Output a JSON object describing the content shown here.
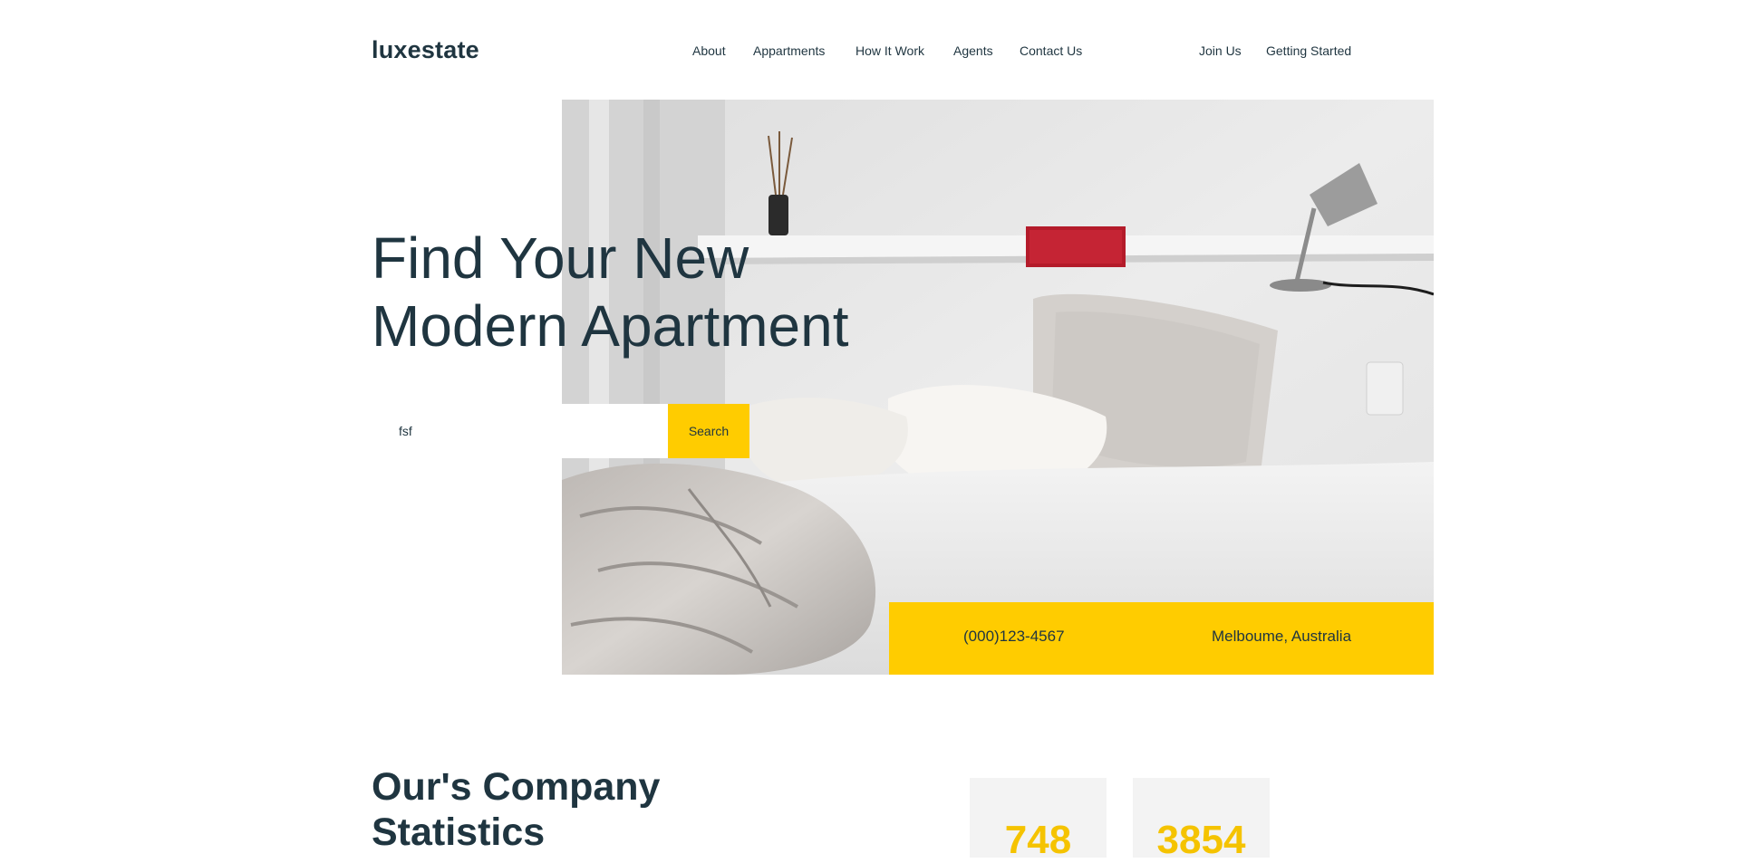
{
  "header": {
    "logo": "luxestate",
    "nav": [
      "About",
      "Appartments",
      "How It Work",
      "Agents",
      "Contact Us"
    ],
    "join_label": "Join Us",
    "getting_started_label": "Getting Started"
  },
  "hero": {
    "headline_line1": "Find Your New",
    "headline_line2": "Modern Apartment",
    "search": {
      "value": "fsf",
      "button_label": "Search"
    },
    "contact": {
      "phone": "(000)123-4567",
      "location": "Melboume, Australia"
    }
  },
  "stats": {
    "title_line1": "Our's Company",
    "title_line2": "Statistics",
    "numbers": [
      "748",
      "3854"
    ]
  },
  "colors": {
    "accent": "#ffcc00",
    "text": "#1f3540",
    "stat_number": "#f5c300"
  }
}
